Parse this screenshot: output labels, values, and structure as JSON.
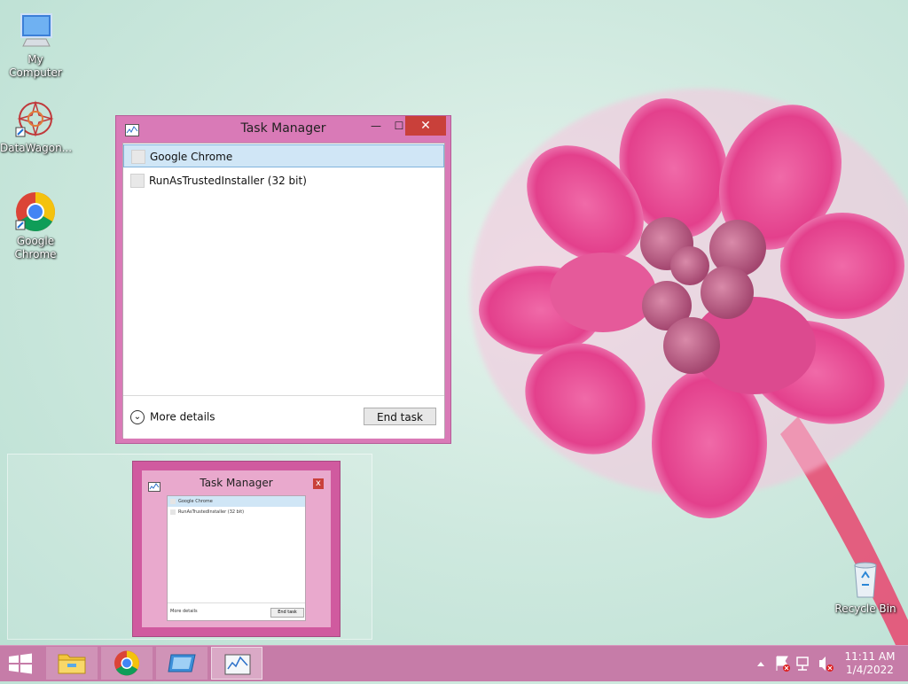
{
  "desktop": {
    "icons": [
      {
        "label": "My Computer"
      },
      {
        "label": "DataWagon..."
      },
      {
        "label": "Google Chrome"
      },
      {
        "label": "Recycle Bin"
      }
    ]
  },
  "window": {
    "title": "Task Manager",
    "minimize_glyph": "—",
    "maximize_glyph": "☐",
    "close_glyph": "✕",
    "processes": [
      {
        "name": "Google Chrome",
        "selected": true
      },
      {
        "name": "RunAsTrustedInstaller (32 bit)",
        "selected": false
      }
    ],
    "more_details_label": "More details",
    "end_task_label": "End task"
  },
  "thumbnail": {
    "title": "Task Manager",
    "close_glyph": "x",
    "processes": [
      "Google Chrome",
      "RunAsTrustedInstaller (32 bit)"
    ],
    "more_details_label": "More details",
    "end_task_label": "End task"
  },
  "taskbar": {
    "apps": [
      "start",
      "file-explorer",
      "google-chrome",
      "remote-desktop",
      "task-manager"
    ],
    "active_app": "task-manager",
    "tray": {
      "time": "11:11 AM",
      "date": "1/4/2022",
      "icons": [
        "chevron-up-icon",
        "action-center-flag-icon",
        "network-icon",
        "speaker-muted-icon"
      ]
    }
  },
  "colors": {
    "accent": "#d97ab7",
    "taskbar": "#c67ca8",
    "close_red": "#c9403a",
    "selection": "#d0e6f6"
  }
}
